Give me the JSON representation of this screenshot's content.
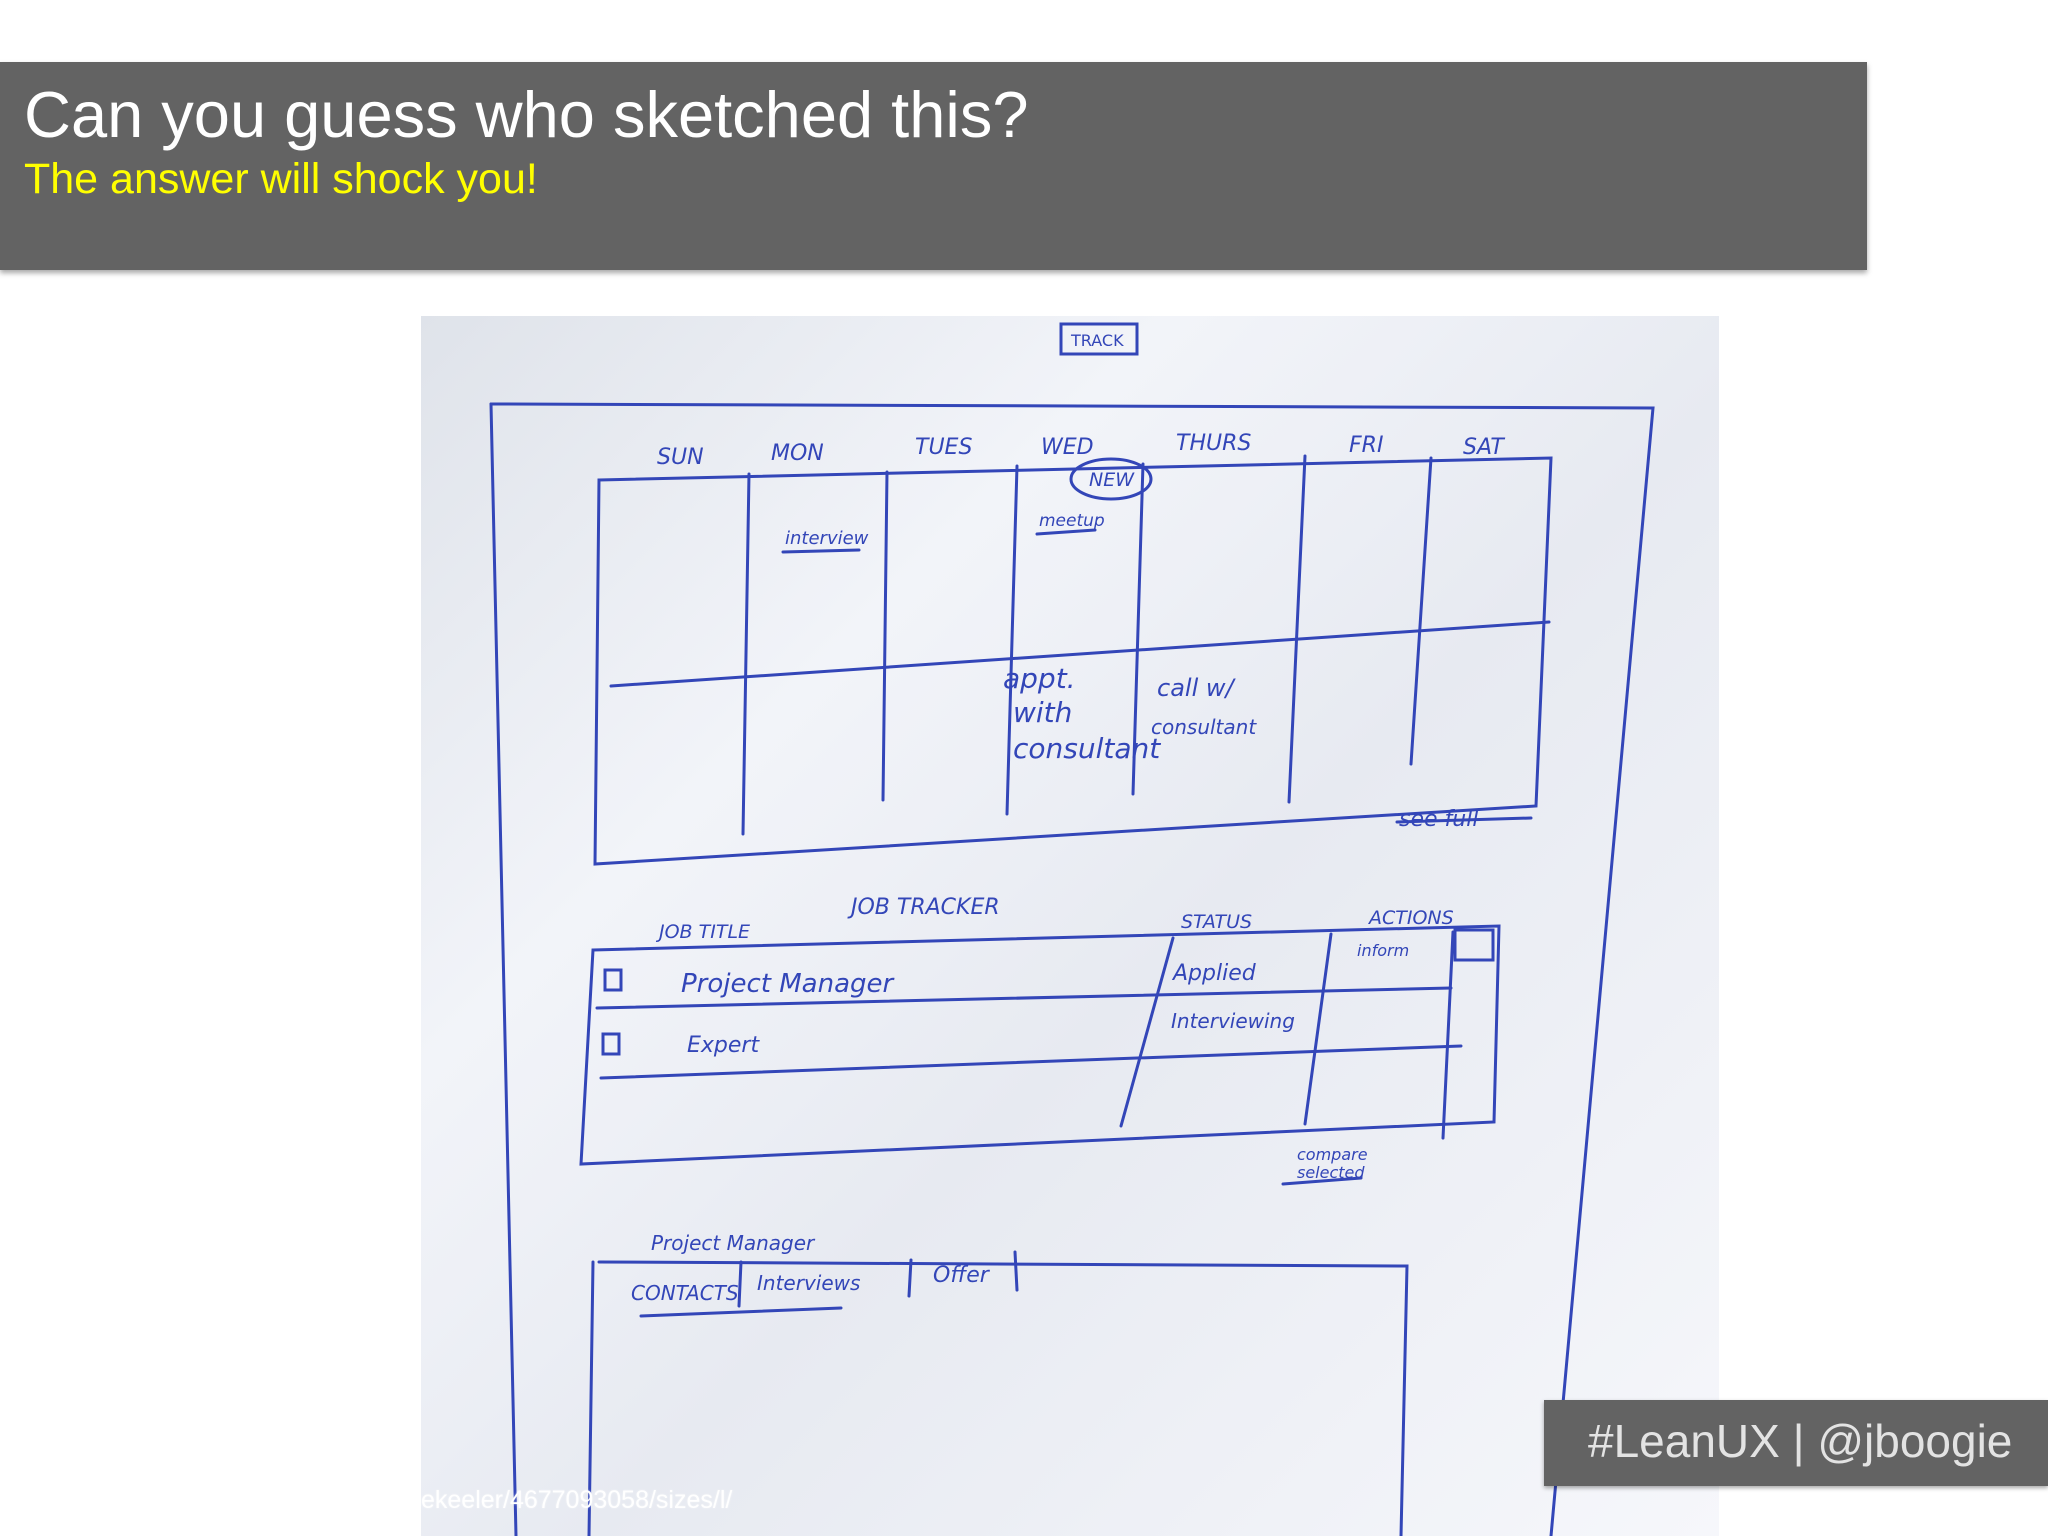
{
  "header": {
    "title": "Can you guess who sketched this?",
    "subtitle": "The answer will shock you!"
  },
  "sketch": {
    "logo": "TRACK",
    "days": [
      "SUN",
      "MON",
      "TUES",
      "WED",
      "THURS",
      "FRI",
      "SAT"
    ],
    "badge": "NEW",
    "calendar_items": {
      "mon": "interview",
      "wed": "meetup",
      "appt": [
        "appt.",
        "with",
        "consultant"
      ],
      "call": [
        "call w/",
        "consultant"
      ]
    },
    "see_full": "see full",
    "tracker": {
      "title": "JOB TRACKER",
      "columns": {
        "job_title": "JOB TITLE",
        "status": "STATUS",
        "actions": "ACTIONS"
      },
      "rows": [
        {
          "title": "Project Manager",
          "status": "Applied",
          "action": "inform",
          "action2": ""
        },
        {
          "title": "Expert",
          "status": "Interviewing"
        }
      ],
      "compare": [
        "compare",
        "selected"
      ]
    },
    "detail": {
      "heading": "Project Manager",
      "tabs": [
        "CONTACTS",
        "Interviews",
        "Offer"
      ]
    }
  },
  "photo_credit": "ekeeler/4677093058/sizes/l/",
  "footer": {
    "hashtag": "#LeanUX | @jboogie"
  },
  "colors": {
    "title_bar": "#636363",
    "title_text": "#ffffff",
    "subtitle_text": "#ffff00",
    "ink": "#3346b8"
  }
}
